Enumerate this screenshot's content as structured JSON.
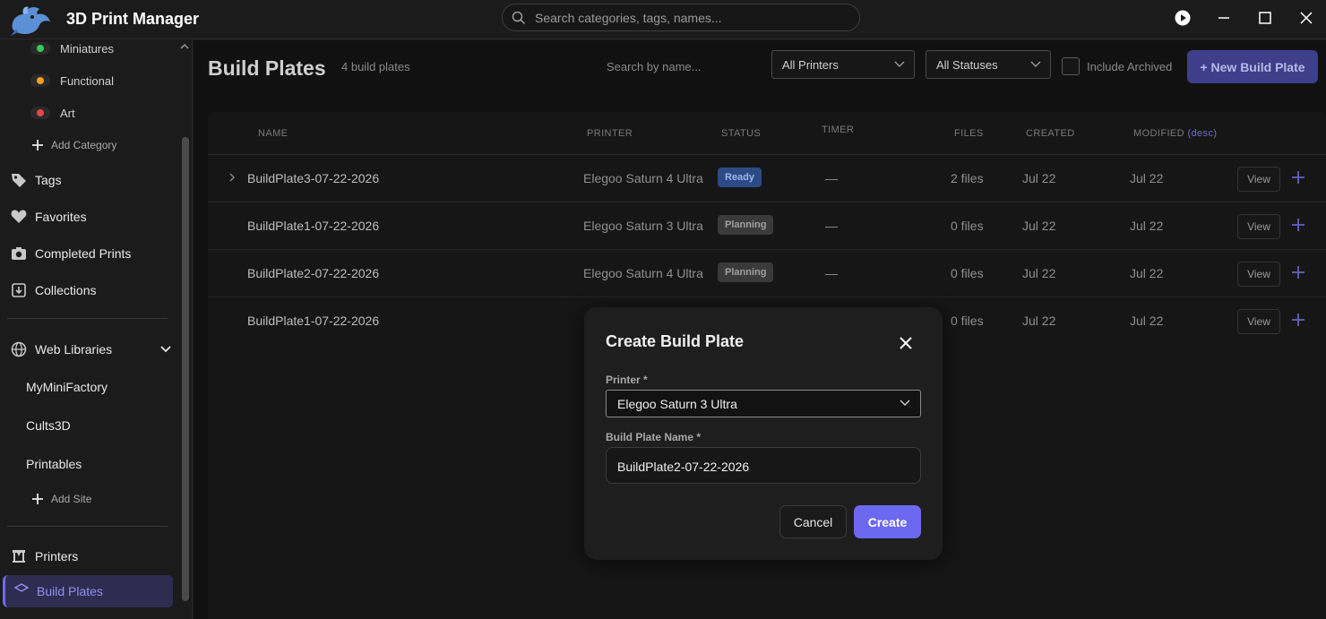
{
  "app": {
    "title": "3D Print Manager"
  },
  "search": {
    "placeholder": "Search categories, tags, names..."
  },
  "sidebar": {
    "categories": [
      {
        "label": "Miniatures",
        "color": "#33cc55"
      },
      {
        "label": "Functional",
        "color": "#f0a020"
      },
      {
        "label": "Art",
        "color": "#e04848"
      }
    ],
    "add_category": "Add Category",
    "tags": "Tags",
    "favorites": "Favorites",
    "completed_prints": "Completed Prints",
    "collections": "Collections",
    "web_libraries": "Web Libraries",
    "sites": [
      "MyMiniFactory",
      "Cults3D",
      "Printables"
    ],
    "add_site": "Add Site",
    "printers": "Printers",
    "build_plates": "Build Plates"
  },
  "main": {
    "title": "Build Plates",
    "count": "4 build plates",
    "search_placeholder": "Search by name...",
    "printer_filter": "All Printers",
    "status_filter": "All Statuses",
    "include_archived": "Include Archived",
    "new_button": "+ New Build Plate",
    "columns": {
      "name": "NAME",
      "printer": "PRINTER",
      "status": "STATUS",
      "timer": "TIMER",
      "files": "FILES",
      "created": "CREATED",
      "modified": "MODIFIED",
      "modified_sort": "(desc)"
    },
    "rows": [
      {
        "name": "BuildPlate3-07-22-2026",
        "printer": "Elegoo Saturn 4 Ultra",
        "status": "Ready",
        "timer": "—",
        "files": "2 files",
        "created": "Jul 22",
        "modified": "Jul 22",
        "view": "View"
      },
      {
        "name": "BuildPlate1-07-22-2026",
        "printer": "Elegoo Saturn 3 Ultra",
        "status": "Planning",
        "timer": "—",
        "files": "0 files",
        "created": "Jul 22",
        "modified": "Jul 22",
        "view": "View"
      },
      {
        "name": "BuildPlate2-07-22-2026",
        "printer": "Elegoo Saturn 4 Ultra",
        "status": "Planning",
        "timer": "—",
        "files": "0 files",
        "created": "Jul 22",
        "modified": "Jul 22",
        "view": "View"
      },
      {
        "name": "BuildPlate1-07-22-2026",
        "printer": "",
        "status": "",
        "timer": "",
        "files": "0 files",
        "created": "Jul 22",
        "modified": "Jul 22",
        "view": "View"
      }
    ]
  },
  "modal": {
    "title": "Create Build Plate",
    "printer_label": "Printer *",
    "printer_value": "Elegoo Saturn 3 Ultra",
    "name_label": "Build Plate Name *",
    "name_value": "BuildPlate2-07-22-2026",
    "cancel": "Cancel",
    "create": "Create"
  },
  "colors": {
    "accent": "#6d68f0",
    "ready_badge": "#2c4a86",
    "planning_badge": "#3a3a3a"
  }
}
